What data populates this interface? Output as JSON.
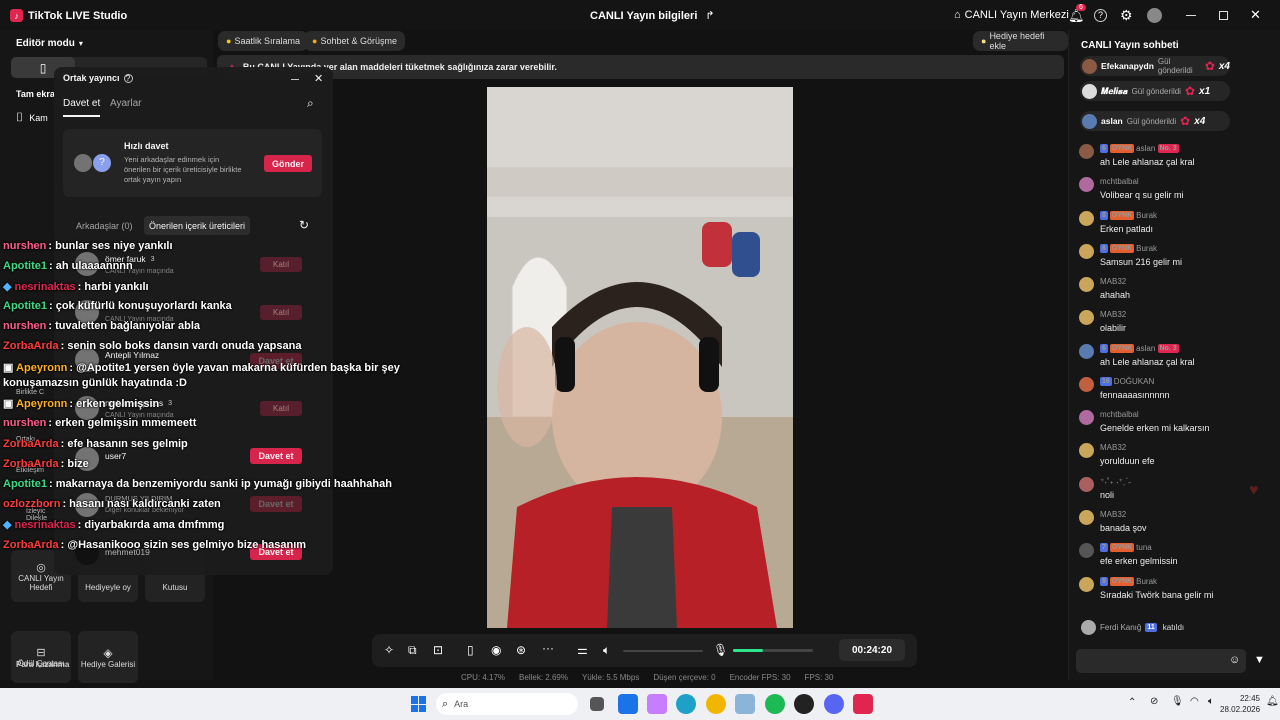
{
  "app": {
    "title": "TikTok LIVE Studio",
    "center_title": "CANLI Yayın bilgileri",
    "live_center": "CANLI Yayın Merkezi",
    "notif_count": "6"
  },
  "left": {
    "editor_mode": "Editör modu",
    "tam_ekran": "Tam ekra",
    "kamera": "Kam",
    "tiles_top": [
      "CANLI Yayın Hedefi",
      "Hediyeyle oy",
      "Kutusu"
    ],
    "tiles_bottom": [
      "Ödül Çantası",
      "Hediye Galerisi"
    ],
    "para": "Para kazanma",
    "bg_labels": [
      "Birlikte C",
      "Ortakı",
      "Etkileşim",
      "İzleyic Dilekle"
    ]
  },
  "center": {
    "tags": [
      "Saatlik Sıralama",
      "Sohbet & Görüşme"
    ],
    "gift_goal": "Hediye hedefi ekle",
    "warning": "Bu CANLI Yayında yer alan maddeleri tüketmek sağlığınıza zarar verebilir.",
    "timer": "00:24:20",
    "stats": [
      "CPU:  4.17%",
      "Bellek:  2.69%",
      "Yükle:  5.5 Mbps",
      "Düşen çerçeve:  0",
      "Encoder FPS:  30",
      "FPS:  30"
    ]
  },
  "dialog": {
    "title": "Ortak yayıncı",
    "tabs": [
      "Davet et",
      "Ayarlar"
    ],
    "quick_title": "Hızlı davet",
    "quick_desc": "Yeni arkadaşlar edinmek için önerilen bir içerik üreticisiyle birlikte ortak yayın yapın",
    "send": "Gönder",
    "sub_tabs": [
      "Arkadaşlar (0)",
      "Önerilen içerik üreticileri"
    ],
    "rows": [
      {
        "name": "ömer faruk",
        "count": "3",
        "sub": "CANLI Yayın maçında",
        "action": "Katıl"
      },
      {
        "name": "",
        "count": "",
        "sub": "CANLI Yayın maçında",
        "action": "Katıl"
      },
      {
        "name": "Antepli Yılmaz",
        "count": "",
        "sub": "",
        "action": "Davet et"
      },
      {
        "name": "makaraexpress",
        "count": "3",
        "sub": "CANLI Yayın maçında",
        "action": "Katıl"
      },
      {
        "name": "user7",
        "count": "",
        "sub": "",
        "action": "Davet et"
      },
      {
        "name": "DURMUŞ YILDIRIM",
        "count": "",
        "sub": "Diğer konuklar bekleniyor",
        "action": "Davet et"
      },
      {
        "name": "mehmet019",
        "count": "",
        "sub": "",
        "action": "Davet et"
      }
    ]
  },
  "overlay_chat": [
    {
      "name": "nurshen",
      "msg": ": bunlar ses niye yankılı",
      "color": "#ff5c8a"
    },
    {
      "name": "Apotite1",
      "msg": ": ah ulaaaannnn",
      "color": "#3ddc84"
    },
    {
      "name": "nesrinaktas",
      "msg": ": harbi yankılı",
      "color": "#e0254e"
    },
    {
      "name": "Apotite1",
      "msg": ": çok küfürlü konuşuyorlardı kanka",
      "color": "#3ddc84"
    },
    {
      "name": "nurshen",
      "msg": ": tuvaletten bağlanıyolar abla",
      "color": "#ff5c8a"
    },
    {
      "name": "ZorbaArda",
      "msg": ": senin solo boks dansın vardı onuda yapsana",
      "color": "#ff3b3b"
    },
    {
      "name": "Apeyronn",
      "msg": ": @Apotite1 yersen öyle yavan makarna küfürden başka bir şey",
      "color": "#ffb020"
    },
    {
      "name": "",
      "msg": "konuşamazsın günlük hayatında :D",
      "color": "#fff"
    },
    {
      "name": "Apeyronn",
      "msg": ": erken gelmişsin",
      "color": "#ffb020"
    },
    {
      "name": "nurshen",
      "msg": ": erken gelmişsin mmemeett",
      "color": "#ff5c8a"
    },
    {
      "name": "ZorbaArda",
      "msg": ": efe hasanın ses gelmip",
      "color": "#ff3b3b"
    },
    {
      "name": "ZorbaArda",
      "msg": ": bize",
      "color": "#ff3b3b"
    },
    {
      "name": "Apotite1",
      "msg": ": makarnaya da benzemiyordu sanki ip yumağı gibiydi haahhahah",
      "color": "#3ddc84"
    },
    {
      "name": "ozlozzborn",
      "msg": ": hasanı nası kaldırcanki zaten",
      "color": "#ff3b3b"
    },
    {
      "name": "nesrinaktas",
      "msg": ": diyarbakırda ama dmfmmg",
      "color": "#e0254e"
    },
    {
      "name": "ZorbaArda",
      "msg": ": @Hasanikooo sizin ses gelmiyo bize hasanım",
      "color": "#ff3b3b"
    }
  ],
  "right": {
    "title": "CANLI Yayın sohbeti",
    "gifts": [
      {
        "name": "Efekanapydn",
        "text": "Gül gönderildi",
        "mult": "x4"
      },
      {
        "name": "𝑴𝒆𝒍𝒊𝒔𝒂",
        "text": "Gül gönderildi",
        "mult": "x1"
      },
      {
        "name": "aslan",
        "text": "Gül gönderildi",
        "mult": "x4"
      }
    ],
    "chat": [
      {
        "b1": "6",
        "b2": "OYNK",
        "name": "aslan",
        "b3": "No. 3",
        "msg": "ah Lele ahlanaz çal kral"
      },
      {
        "b1": "",
        "b2": "",
        "name": "mchtbalbal",
        "b3": "",
        "msg": "Volibear q su gelir mi"
      },
      {
        "b1": "8",
        "b2": "OYNK",
        "name": "Burak",
        "b3": "",
        "msg": "Erken patladı"
      },
      {
        "b1": "8",
        "b2": "OYNK",
        "name": "Burak",
        "b3": "",
        "msg": "Samsun 216 gelir mi"
      },
      {
        "b1": "",
        "b2": "",
        "name": "MAB32",
        "b3": "",
        "msg": "ahahah"
      },
      {
        "b1": "",
        "b2": "",
        "name": "MAB32",
        "b3": "",
        "msg": "olabilir"
      },
      {
        "b1": "6",
        "b2": "OYNK",
        "name": "aslan",
        "b3": "No. 3",
        "msg": "ah Lele ahlanaz çal kral"
      },
      {
        "b1": "16",
        "b2": "",
        "name": "DOĞUKAN",
        "b3": "",
        "msg": "fennaaaasınnnnn"
      },
      {
        "b1": "",
        "b2": "",
        "name": "mchtbalbal",
        "b3": "",
        "msg": "Genelde erken mi kalkarsın"
      },
      {
        "b1": "",
        "b2": "",
        "name": "MAB32",
        "b3": "",
        "msg": "yorulduun efe"
      },
      {
        "b1": "",
        "b2": "",
        "name": "⁺˖˚₊ ˖⁺ˎˊ˗",
        "b3": "",
        "msg": "noli"
      },
      {
        "b1": "",
        "b2": "",
        "name": "MAB32",
        "b3": "",
        "msg": "banada şov"
      },
      {
        "b1": "7",
        "b2": "OYNK",
        "name": "tuna",
        "b3": "",
        "msg": "efe erken gelmissin"
      },
      {
        "b1": "8",
        "b2": "OYNK",
        "name": "Burak",
        "b3": "",
        "msg": "Sıradaki Twörk bana gelir mi"
      }
    ],
    "joined": {
      "name": "Ferdi Kanığ",
      "badge": "11",
      "text": "katıldı"
    }
  },
  "taskbar": {
    "search": "Ara",
    "time": "22:45",
    "date": "28.02.2026"
  }
}
